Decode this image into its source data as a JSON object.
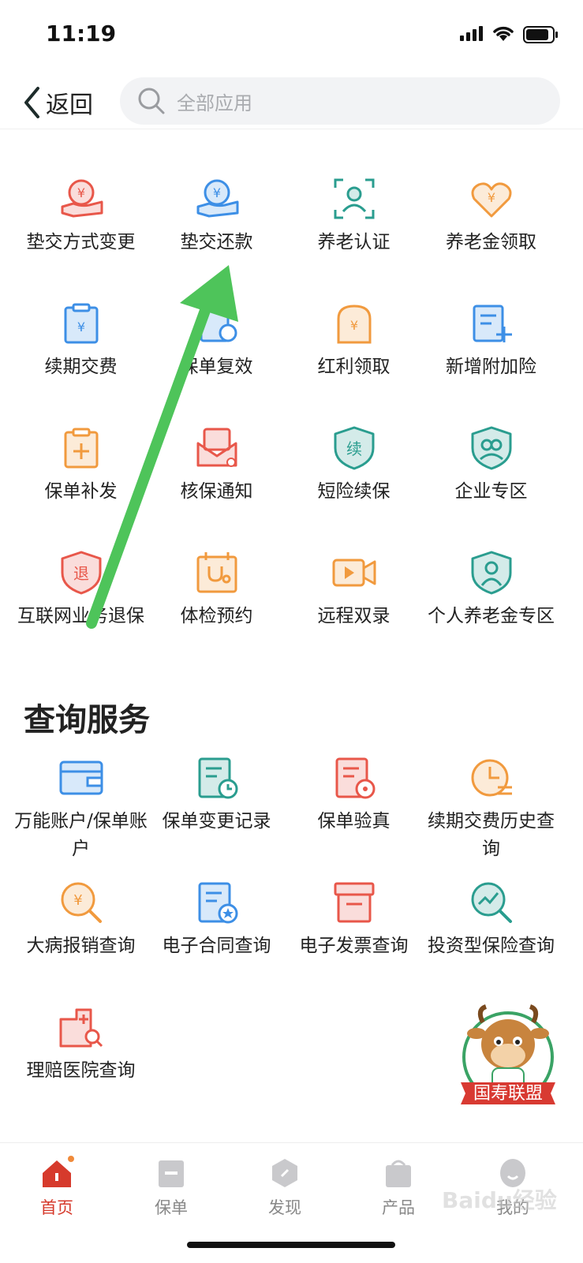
{
  "status_bar": {
    "time": "11:19"
  },
  "header": {
    "back_label": "返回",
    "search_placeholder": "全部应用"
  },
  "top_grid": [
    {
      "label": "垫交方式变更",
      "icon": "hand-rmb-swap-icon",
      "color": "#e8574a"
    },
    {
      "label": "垫交还款",
      "icon": "hand-rmb-icon",
      "color": "#3d8fe6"
    },
    {
      "label": "养老认证",
      "icon": "face-scan-icon",
      "color": "#2a9d8f"
    },
    {
      "label": "养老金领取",
      "icon": "heart-rmb-icon",
      "color": "#f19a3e"
    },
    {
      "label": "续期交费",
      "icon": "clipboard-rmb-icon",
      "color": "#3d8fe6"
    },
    {
      "label": "保单复效",
      "icon": "document-refresh-icon",
      "color": "#3d8fe6"
    },
    {
      "label": "红利领取",
      "icon": "tombstone-rmb-icon",
      "color": "#f19a3e"
    },
    {
      "label": "新增附加险",
      "icon": "document-plus-icon",
      "color": "#3d8fe6"
    },
    {
      "label": "保单补发",
      "icon": "clipboard-plus-icon",
      "color": "#f19a3e"
    },
    {
      "label": "核保通知",
      "icon": "envelope-user-icon",
      "color": "#e8574a"
    },
    {
      "label": "短险续保",
      "icon": "shield-renew-icon",
      "color": "#2a9d8f"
    },
    {
      "label": "企业专区",
      "icon": "shield-group-icon",
      "color": "#2a9d8f"
    },
    {
      "label": "互联网业务退保",
      "icon": "shield-tui-icon",
      "color": "#e8574a"
    },
    {
      "label": "体检预约",
      "icon": "calendar-stethoscope-icon",
      "color": "#f19a3e"
    },
    {
      "label": "远程双录",
      "icon": "video-camera-icon",
      "color": "#f19a3e"
    },
    {
      "label": "个人养老金专区",
      "icon": "shield-elder-icon",
      "color": "#2a9d8f"
    }
  ],
  "query_section": {
    "title": "查询服务",
    "items": [
      {
        "label": "万能账户/保单账户",
        "icon": "wallet-icon",
        "color": "#3d8fe6"
      },
      {
        "label": "保单变更记录",
        "icon": "document-clock-icon",
        "color": "#2a9d8f"
      },
      {
        "label": "保单验真",
        "icon": "document-eye-icon",
        "color": "#e8574a"
      },
      {
        "label": "续期交费历史查询",
        "icon": "clock-pie-icon",
        "color": "#f19a3e"
      },
      {
        "label": "大病报销查询",
        "icon": "rmb-magnifier-icon",
        "color": "#f19a3e"
      },
      {
        "label": "电子合同查询",
        "icon": "document-badge-icon",
        "color": "#3d8fe6"
      },
      {
        "label": "电子发票查询",
        "icon": "invoice-box-icon",
        "color": "#e8574a"
      },
      {
        "label": "投资型保险查询",
        "icon": "trend-magnifier-icon",
        "color": "#2a9d8f"
      },
      {
        "label": "理赔医院查询",
        "icon": "hospital-search-icon",
        "color": "#e8574a"
      }
    ]
  },
  "mascot": {
    "banner_text": "国寿联盟"
  },
  "tab_bar": {
    "tabs": [
      {
        "label": "首页",
        "icon": "home-icon",
        "active": true
      },
      {
        "label": "保单",
        "icon": "policy-icon",
        "active": false
      },
      {
        "label": "发现",
        "icon": "discover-icon",
        "active": false
      },
      {
        "label": "产品",
        "icon": "product-bag-icon",
        "active": false
      },
      {
        "label": "我的",
        "icon": "profile-icon",
        "active": false
      }
    ]
  },
  "watermark": "Baidu经验"
}
